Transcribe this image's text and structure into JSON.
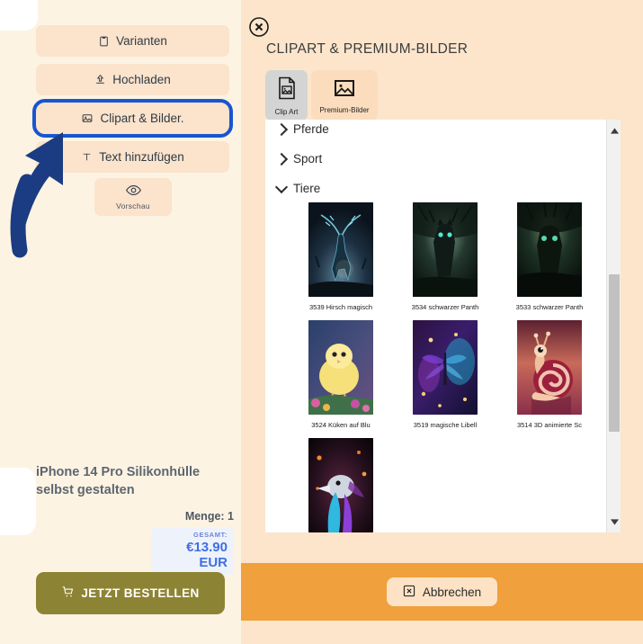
{
  "left_panel": {
    "tools": [
      {
        "label": "Varianten",
        "icon": "clipboard-icon",
        "selected": false
      },
      {
        "label": "Hochladen",
        "icon": "upload-icon",
        "selected": false
      },
      {
        "label": "Clipart & Bilder.",
        "icon": "image-icon",
        "selected": true
      },
      {
        "label": "Text hinzufügen",
        "icon": "text-icon",
        "selected": false
      }
    ],
    "preview": {
      "label": "Vorschau",
      "icon": "eye-icon"
    },
    "product": {
      "title": "iPhone 14 Pro Silikonhülle selbst gestalten",
      "quantity_label": "Menge: 1",
      "total_label": "GESAMT:",
      "total_value": "€13.90 EUR"
    },
    "order_button": {
      "label": "JETZT BESTELLEN",
      "icon": "cart-icon"
    },
    "highlight_color": "#1755d1",
    "annotation": {
      "name": "curved-arrow",
      "color": "#1b3c82"
    }
  },
  "modal": {
    "title": "CLIPART & PREMIUM-BILDER",
    "close_icon": "close-circle-icon",
    "tabs": [
      {
        "label": "Clip Art",
        "icon": "clipart-file-icon",
        "active": true
      },
      {
        "label": "Premium-Bilder",
        "icon": "premium-image-icon",
        "active": false
      }
    ],
    "categories": [
      {
        "label": "Pferde",
        "expanded": false,
        "clipped": true
      },
      {
        "label": "Sport",
        "expanded": false,
        "clipped": false
      },
      {
        "label": "Tiere",
        "expanded": true,
        "clipped": false
      }
    ],
    "thumbnails": [
      {
        "label": "3539 Hirsch magisch",
        "art": "deer"
      },
      {
        "label": "3534 schwarzer Panth",
        "art": "panther"
      },
      {
        "label": "3533 schwarzer Panth",
        "art": "panther2"
      },
      {
        "label": "3524 Küken auf Blu",
        "art": "chick"
      },
      {
        "label": "3519 magische Libell",
        "art": "dragonfly"
      },
      {
        "label": "3514 3D animierte Sc",
        "art": "snail"
      },
      {
        "label": "",
        "art": "bird"
      }
    ],
    "scrollbar": {
      "up_icon": "scroll-up-icon",
      "down_icon": "scroll-down-icon"
    },
    "footer": {
      "cancel_label": "Abbrechen",
      "cancel_icon": "close-box-icon",
      "bar_color": "#f0a03c"
    }
  }
}
